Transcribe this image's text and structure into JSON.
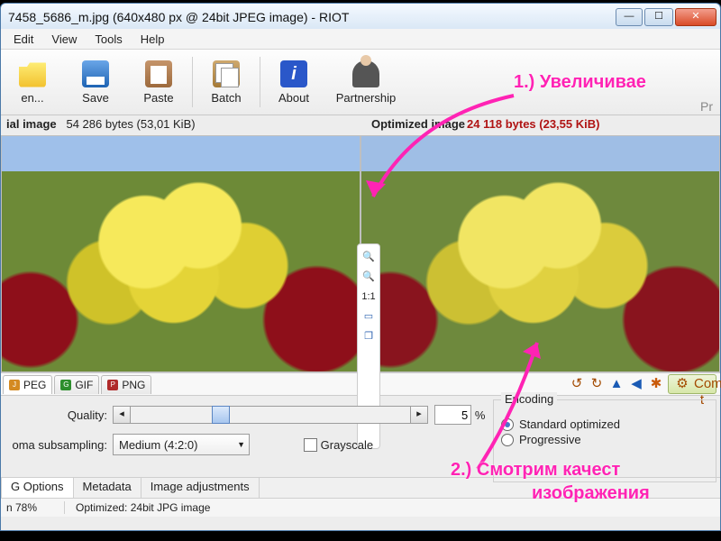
{
  "title": "7458_5686_m.jpg (640x480 px @ 24bit JPEG image) - RIOT",
  "menu": {
    "edit": "Edit",
    "view": "View",
    "tools": "Tools",
    "help": "Help"
  },
  "toolbar": {
    "open": "en...",
    "save": "Save",
    "paste": "Paste",
    "batch": "Batch",
    "about": "About",
    "partnership": "Partnership",
    "pr": "Pr"
  },
  "info": {
    "left_label": "ial image",
    "left_bytes": "54 286 bytes (53,01 KiB)",
    "right_label": "Optimized image",
    "right_bytes": "24 118 bytes (23,55 KiB)"
  },
  "midtools": {
    "zoom": "🔍",
    "ratio": "1:1",
    "fit": "▭",
    "dual": "❐"
  },
  "formattabs": {
    "jpeg": "PEG",
    "gif": "GIF",
    "png": "PNG"
  },
  "rtools": {
    "compress": "Compress t"
  },
  "quality": {
    "label": "Quality:",
    "value": "5",
    "pct": "%"
  },
  "chroma": {
    "label": "oma subsampling:",
    "value": "Medium (4:2:0)"
  },
  "grayscale": "Grayscale",
  "encoding": {
    "title": "Encoding",
    "std": "Standard optimized",
    "prog": "Progressive"
  },
  "bottabs": {
    "opts": "G Options",
    "meta": "Metadata",
    "adj": "Image adjustments"
  },
  "status": {
    "zoom": "n 78%",
    "info": "Optimized: 24bit JPG image"
  },
  "annot": {
    "a1": "1.) Увеличивае",
    "a2": "2.) Смотрим качест",
    "a2b": "изображения"
  }
}
